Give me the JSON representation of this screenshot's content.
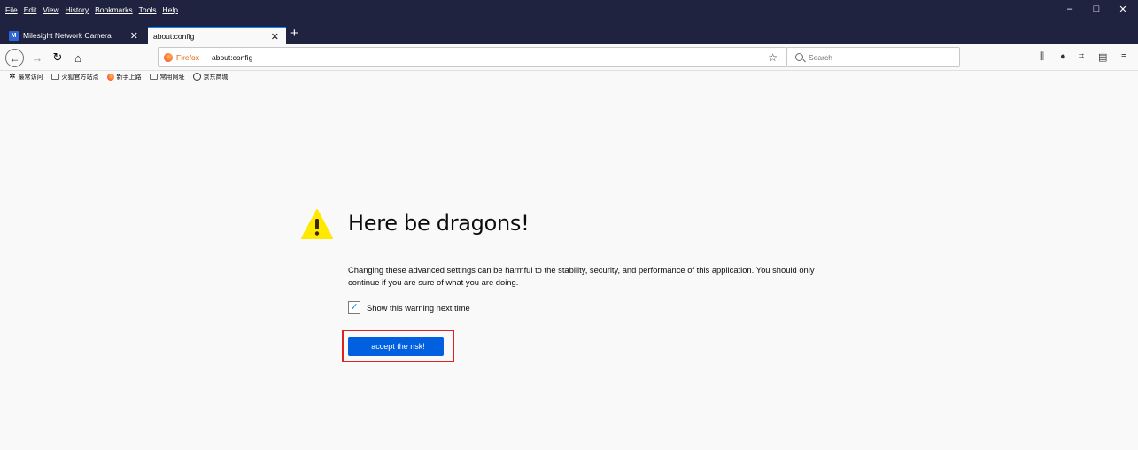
{
  "menubar": [
    "File",
    "Edit",
    "View",
    "History",
    "Bookmarks",
    "Tools",
    "Help"
  ],
  "window_controls": {
    "minimize": "–",
    "maximize": "□",
    "close": "✕"
  },
  "tabs": [
    {
      "favicon": "M",
      "title": "Milesight Network Camera",
      "close": "✕"
    },
    {
      "title": "about:config",
      "close": "✕"
    }
  ],
  "newtab": "+",
  "navbar": {
    "identity": "Firefox",
    "url": "about:config",
    "search_placeholder": "Search"
  },
  "bookmarks": [
    "最常访问",
    "火狐官方站点",
    "新手上路",
    "常用网址",
    "京东商城"
  ],
  "warning": {
    "title": "Here be dragons!",
    "text": "Changing these advanced settings can be harmful to the stability, security, and performance of this application. You should only continue if you are sure of what you are doing.",
    "checkbox_label": "Show this warning next time",
    "checkbox_checked": true,
    "accept_label": "I accept the risk!"
  },
  "colors": {
    "titlebar": "#202340",
    "accent": "#0060df",
    "highlight": "#e02121"
  }
}
